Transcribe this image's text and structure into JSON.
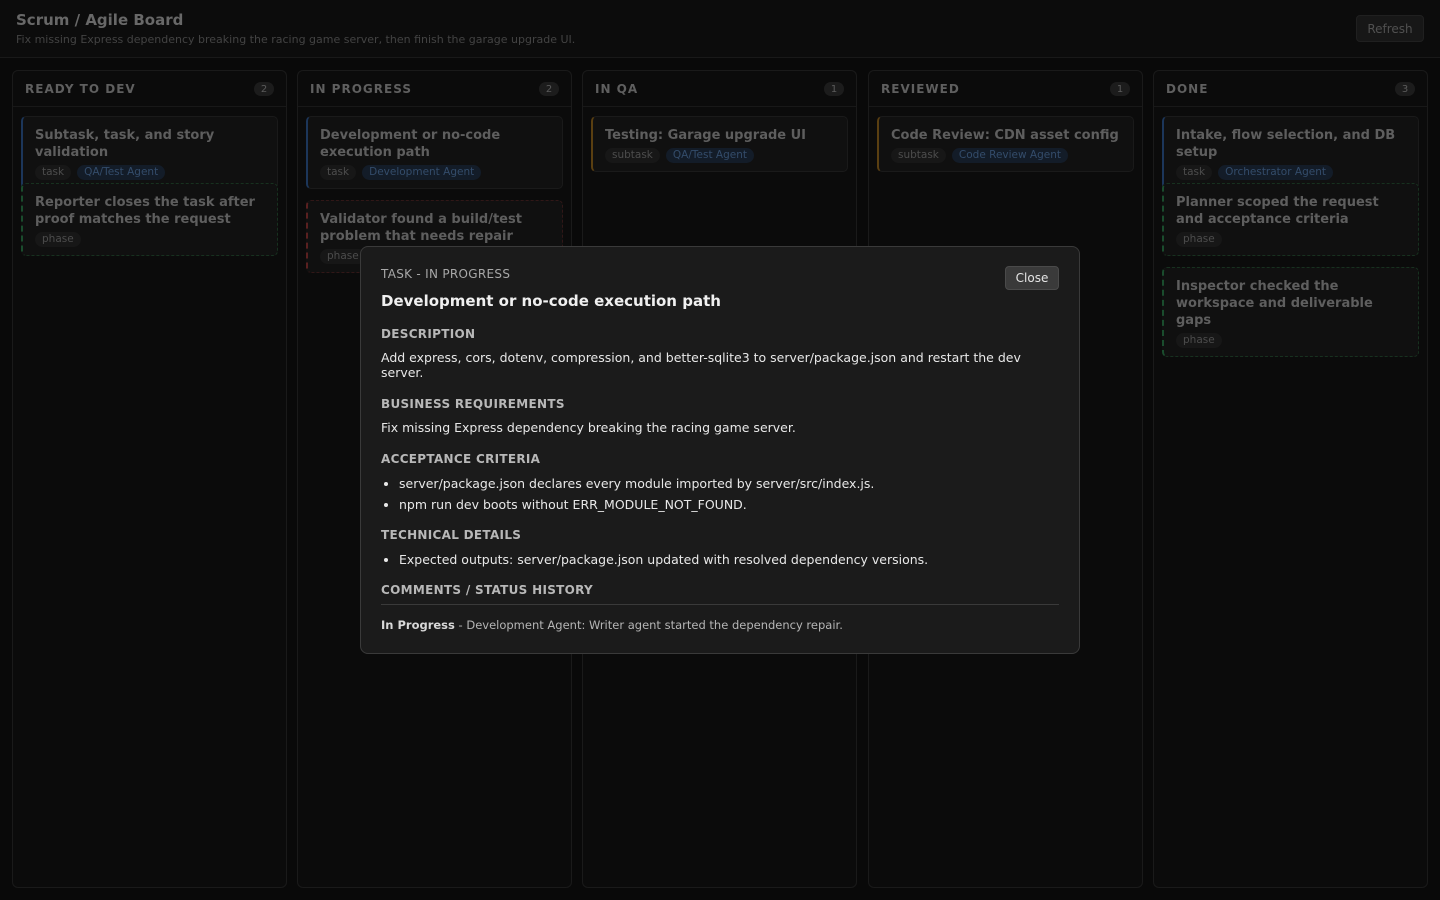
{
  "header": {
    "title": "Scrum / Agile Board",
    "subtitle": "Fix missing Express dependency breaking the racing game server, then finish the garage upgrade UI.",
    "refresh_label": "Refresh"
  },
  "columns": [
    {
      "title": "READY TO DEV",
      "count": "2",
      "cards": [
        {
          "title": "Subtask, task, and story validation",
          "type": "task",
          "agent": "QA/Test Agent"
        },
        {
          "title": "Reporter closes the task after proof matches the request",
          "type": "phase",
          "agent": ""
        }
      ]
    },
    {
      "title": "IN PROGRESS",
      "count": "2",
      "cards": [
        {
          "title": "Development or no-code execution path",
          "type": "task",
          "agent": "Development Agent"
        },
        {
          "title": "Validator found a build/test problem that needs repair",
          "type": "phase",
          "agent": ""
        }
      ]
    },
    {
      "title": "IN QA",
      "count": "1",
      "cards": [
        {
          "title": "Testing: Garage upgrade UI",
          "type": "subtask",
          "agent": "QA/Test Agent"
        }
      ]
    },
    {
      "title": "REVIEWED",
      "count": "1",
      "cards": [
        {
          "title": "Code Review: CDN asset config",
          "type": "subtask",
          "agent": "Code Review Agent"
        }
      ]
    },
    {
      "title": "DONE",
      "count": "3",
      "cards": [
        {
          "title": "Intake, flow selection, and DB setup",
          "type": "task",
          "agent": "Orchestrator Agent"
        },
        {
          "title": "Planner scoped the request and acceptance criteria",
          "type": "phase",
          "agent": ""
        },
        {
          "title": "Inspector checked the workspace and deliverable gaps",
          "type": "phase",
          "agent": ""
        }
      ]
    }
  ],
  "modal": {
    "eyebrow": "TASK - IN PROGRESS",
    "title": "Development or no-code execution path",
    "close_label": "Close",
    "description_label": "DESCRIPTION",
    "description": "Add express, cors, dotenv, compression, and better-sqlite3 to server/package.json and restart the dev server.",
    "business_label": "BUSINESS REQUIREMENTS",
    "business": "Fix missing Express dependency breaking the racing game server.",
    "acceptance_label": "ACCEPTANCE CRITERIA",
    "acceptance": [
      "server/package.json declares every module imported by server/src/index.js.",
      "npm run dev boots without ERR_MODULE_NOT_FOUND."
    ],
    "technical_label": "TECHNICAL DETAILS",
    "technical": [
      "Expected outputs: server/package.json updated with resolved dependency versions."
    ],
    "comments_label": "COMMENTS / STATUS HISTORY",
    "comment_status": "In Progress",
    "comment_text": " - Development Agent: Writer agent started the dependency repair."
  }
}
